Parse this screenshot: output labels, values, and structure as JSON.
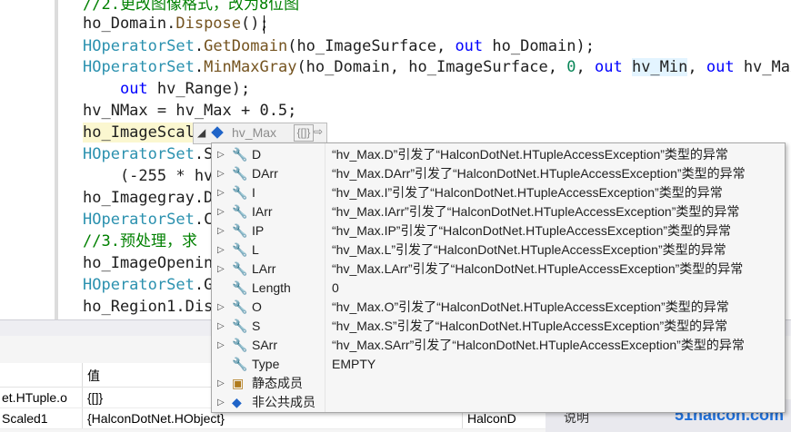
{
  "editor": {
    "lines": [
      {
        "parts": [
          {
            "t": "//2.更改图像格式，改为8位图",
            "c": "cm"
          }
        ]
      },
      {
        "parts": [
          {
            "t": "ho_Domain.",
            "c": ""
          },
          {
            "t": "Dispose",
            "c": "mt"
          },
          {
            "t": "();",
            "c": ""
          }
        ]
      },
      {
        "parts": [
          {
            "t": "HOperatorSet",
            "c": "ty"
          },
          {
            "t": ".",
            "c": ""
          },
          {
            "t": "GetDomain",
            "c": "mt"
          },
          {
            "t": "(ho_ImageSurface, ",
            "c": ""
          },
          {
            "t": "out",
            "c": "kw"
          },
          {
            "t": " ho_Domain);",
            "c": ""
          }
        ]
      },
      {
        "parts": [
          {
            "t": "HOperatorSet",
            "c": "ty"
          },
          {
            "t": ".",
            "c": ""
          },
          {
            "t": "MinMaxGray",
            "c": "mt"
          },
          {
            "t": "(ho_Domain, ho_ImageSurface, ",
            "c": ""
          },
          {
            "t": "0",
            "c": "num"
          },
          {
            "t": ", ",
            "c": ""
          },
          {
            "t": "out",
            "c": "kw"
          },
          {
            "t": " ",
            "c": ""
          },
          {
            "t": "hv_Min",
            "c": "hi"
          },
          {
            "t": ", ",
            "c": ""
          },
          {
            "t": "out",
            "c": "kw"
          },
          {
            "t": " hv_Max,",
            "c": ""
          }
        ]
      },
      {
        "parts": [
          {
            "t": "    ",
            "c": ""
          },
          {
            "t": "out",
            "c": "kw"
          },
          {
            "t": " hv_Range);",
            "c": ""
          }
        ]
      },
      {
        "parts": [
          {
            "t": "hv_NMax = hv_Max + 0.5;",
            "c": ""
          }
        ]
      },
      {
        "parts": [
          {
            "t": "ho_ImageScal",
            "c": ""
          }
        ]
      },
      {
        "parts": [
          {
            "t": "HOperatorSet",
            "c": "ty"
          },
          {
            "t": ".S",
            "c": ""
          }
        ]
      },
      {
        "parts": [
          {
            "t": "    (-255 * hv",
            "c": ""
          }
        ]
      },
      {
        "parts": [
          {
            "t": "ho_Imagegray.D",
            "c": ""
          }
        ]
      },
      {
        "parts": [
          {
            "t": "HOperatorSet",
            "c": "ty"
          },
          {
            "t": ".C",
            "c": ""
          }
        ]
      },
      {
        "parts": [
          {
            "t": "//3.预处理，求",
            "c": "cm"
          }
        ]
      },
      {
        "parts": [
          {
            "t": "ho_ImageOpenin",
            "c": ""
          }
        ]
      },
      {
        "parts": [
          {
            "t": "HOperatorSet",
            "c": "ty"
          },
          {
            "t": ".G",
            "c": ""
          }
        ]
      },
      {
        "parts": [
          {
            "t": "ho_Region1.Dis",
            "c": ""
          }
        ]
      }
    ]
  },
  "datatip": {
    "name": "hv_Max",
    "brace": "{[]}",
    "rows": [
      {
        "label": "D",
        "value": "“hv_Max.D”引发了“HalconDotNet.HTupleAccessException”类型的异常",
        "expand": true,
        "icon": "wrench"
      },
      {
        "label": "DArr",
        "value": "“hv_Max.DArr”引发了“HalconDotNet.HTupleAccessException”类型的异常",
        "expand": true,
        "icon": "wrench"
      },
      {
        "label": "I",
        "value": "“hv_Max.I”引发了“HalconDotNet.HTupleAccessException”类型的异常",
        "expand": true,
        "icon": "wrench"
      },
      {
        "label": "IArr",
        "value": "“hv_Max.IArr”引发了“HalconDotNet.HTupleAccessException”类型的异常",
        "expand": true,
        "icon": "wrench"
      },
      {
        "label": "IP",
        "value": "“hv_Max.IP”引发了“HalconDotNet.HTupleAccessException”类型的异常",
        "expand": true,
        "icon": "wrench"
      },
      {
        "label": "L",
        "value": "“hv_Max.L”引发了“HalconDotNet.HTupleAccessException”类型的异常",
        "expand": true,
        "icon": "wrench"
      },
      {
        "label": "LArr",
        "value": "“hv_Max.LArr”引发了“HalconDotNet.HTupleAccessException”类型的异常",
        "expand": true,
        "icon": "wrench"
      },
      {
        "label": "Length",
        "value": "0",
        "expand": false,
        "icon": "wrench"
      },
      {
        "label": "O",
        "value": "“hv_Max.O”引发了“HalconDotNet.HTupleAccessException”类型的异常",
        "expand": true,
        "icon": "wrench"
      },
      {
        "label": "S",
        "value": "“hv_Max.S”引发了“HalconDotNet.HTupleAccessException”类型的异常",
        "expand": true,
        "icon": "wrench"
      },
      {
        "label": "SArr",
        "value": "“hv_Max.SArr”引发了“HalconDotNet.HTupleAccessException”类型的异常",
        "expand": true,
        "icon": "wrench"
      },
      {
        "label": "Type",
        "value": "EMPTY",
        "expand": false,
        "icon": "wrench"
      },
      {
        "label": "静态成员",
        "value": "",
        "expand": true,
        "icon": "static"
      },
      {
        "label": "非公共成员",
        "value": "",
        "expand": true,
        "icon": "cube"
      }
    ]
  },
  "locals": {
    "value_header": "值",
    "rows": [
      {
        "name": "et.HTuple.o",
        "value": "{[]}",
        "type": ""
      },
      {
        "name": "Scaled1",
        "value": "{HalconDotNet.HObject}",
        "type": "HalconD"
      }
    ]
  },
  "right_panel": {
    "label": "说明"
  },
  "watermark": "51halcon.com"
}
